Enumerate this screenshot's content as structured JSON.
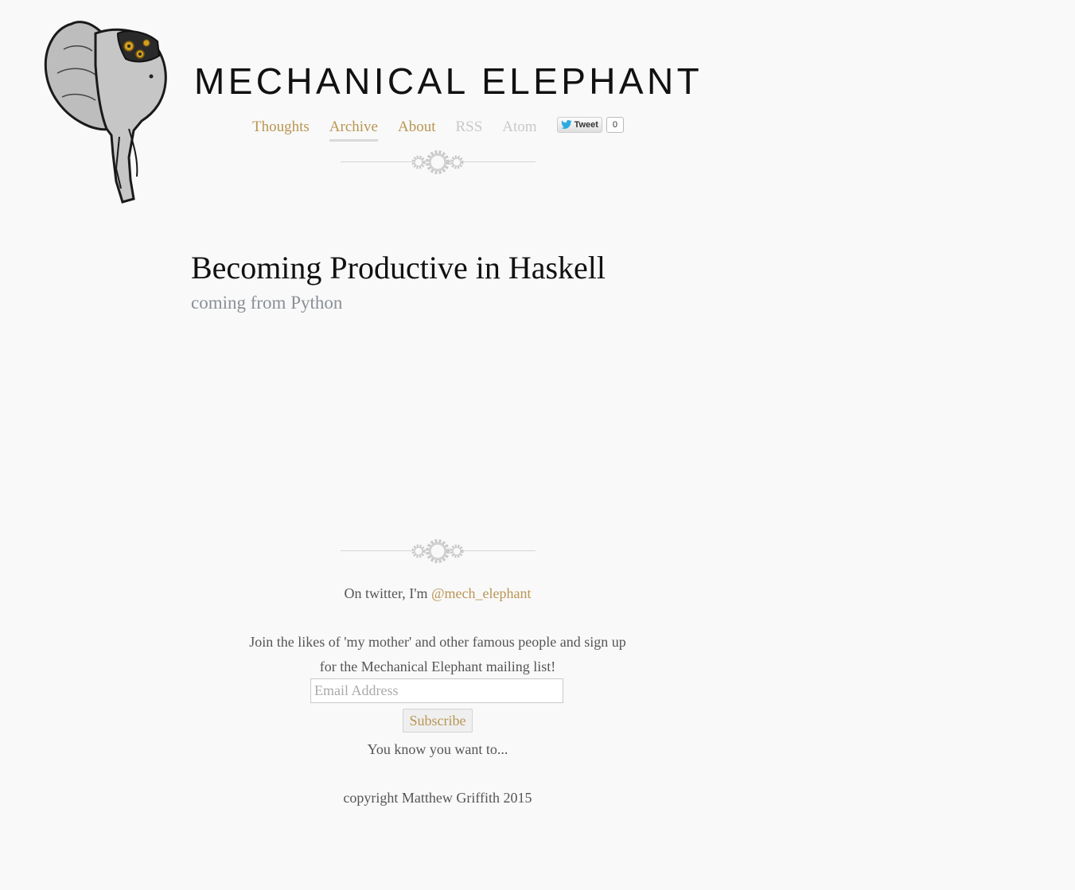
{
  "site": {
    "title": "MECHANICAL ELEPHANT",
    "logo": "mechanical-elephant-logo"
  },
  "nav": {
    "items": [
      {
        "label": "Thoughts",
        "color": "#b99553",
        "active": false
      },
      {
        "label": "Archive",
        "color": "#b99553",
        "active": true
      },
      {
        "label": "About",
        "color": "#b99553",
        "active": false
      },
      {
        "label": "RSS",
        "color": "#c8c8c8",
        "active": false
      },
      {
        "label": "Atom",
        "color": "#c8c8c8",
        "active": false
      }
    ],
    "tweet": {
      "label": "Tweet",
      "count": "0",
      "icon": "twitter-bird-icon"
    }
  },
  "post": {
    "title": "Becoming Productive in Haskell",
    "subtitle": "coming from Python"
  },
  "footer": {
    "twitter_prefix": "On twitter, I'm ",
    "twitter_handle": "@mech_elephant",
    "mailing_line1": "Join the likes of 'my mother' and other famous people and sign up",
    "mailing_line2": "for the Mechanical Elephant mailing list!",
    "email_placeholder": "Email Address",
    "subscribe_label": "Subscribe",
    "tagline": "You know you want to...",
    "copyright": "copyright Matthew Griffith 2015"
  },
  "colors": {
    "accent": "#b99553",
    "muted": "#c8c8c8",
    "background": "#f9f9f9"
  }
}
